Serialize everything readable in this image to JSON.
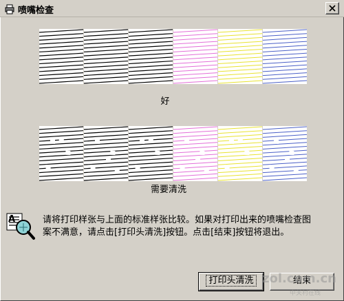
{
  "window": {
    "title": "喷嘴检查",
    "icons": {
      "app": "printer-app-icon",
      "close": "close-icon",
      "message": "inspect-icon"
    }
  },
  "patterns": {
    "good_label": "好",
    "bad_label": "需要清洗",
    "colors": {
      "black": "#000000",
      "magenta": "#e36ed8",
      "yellow": "#e8e230",
      "cyan": "#4a5fc7"
    },
    "panels": [
      "black",
      "black",
      "black",
      "magenta",
      "yellow",
      "cyan"
    ]
  },
  "message": {
    "line1": "请将打印样张与上面的标准样张比较。如果对打印出来的喷嘴检查图",
    "line2": "案不满意，请点击[打印头清洗]按钮。点击[结束]按钮将退出。"
  },
  "buttons": {
    "clean": "打印头清洗",
    "finish": "结束"
  },
  "watermark": {
    "text": "zol.com.cn",
    "sub": "中关村在线"
  }
}
